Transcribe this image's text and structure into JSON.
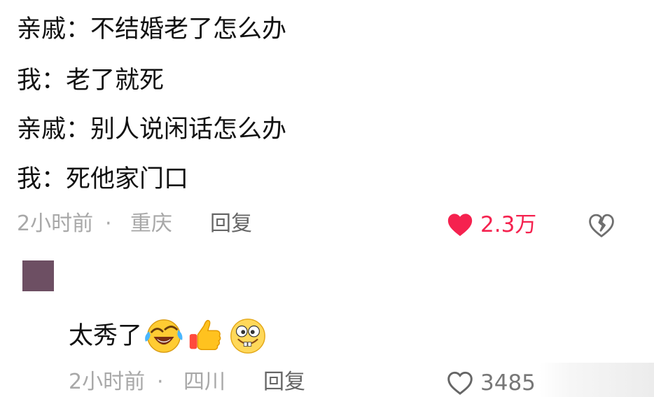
{
  "comment": {
    "lines": [
      "亲戚：不结婚老了怎么办",
      "我：老了就死",
      "亲戚：别人说闲话怎么办",
      "我：死他家门口"
    ],
    "time": "2小时前",
    "location": "重庆",
    "reply_label": "回复",
    "likes": "2.3万",
    "like_color": "#f5224f"
  },
  "sub_reply": {
    "text": "太秀了",
    "emojis": [
      "laughing-crying-emoji",
      "thumbs-up-emoji",
      "grinning-emoji"
    ],
    "time": "2小时前",
    "location": "四川",
    "reply_label": "回复",
    "likes": "3485"
  },
  "colors": {
    "meta_gray": "#a8a8a8",
    "text_dark": "#111111",
    "avatar": "#6d4f63"
  }
}
